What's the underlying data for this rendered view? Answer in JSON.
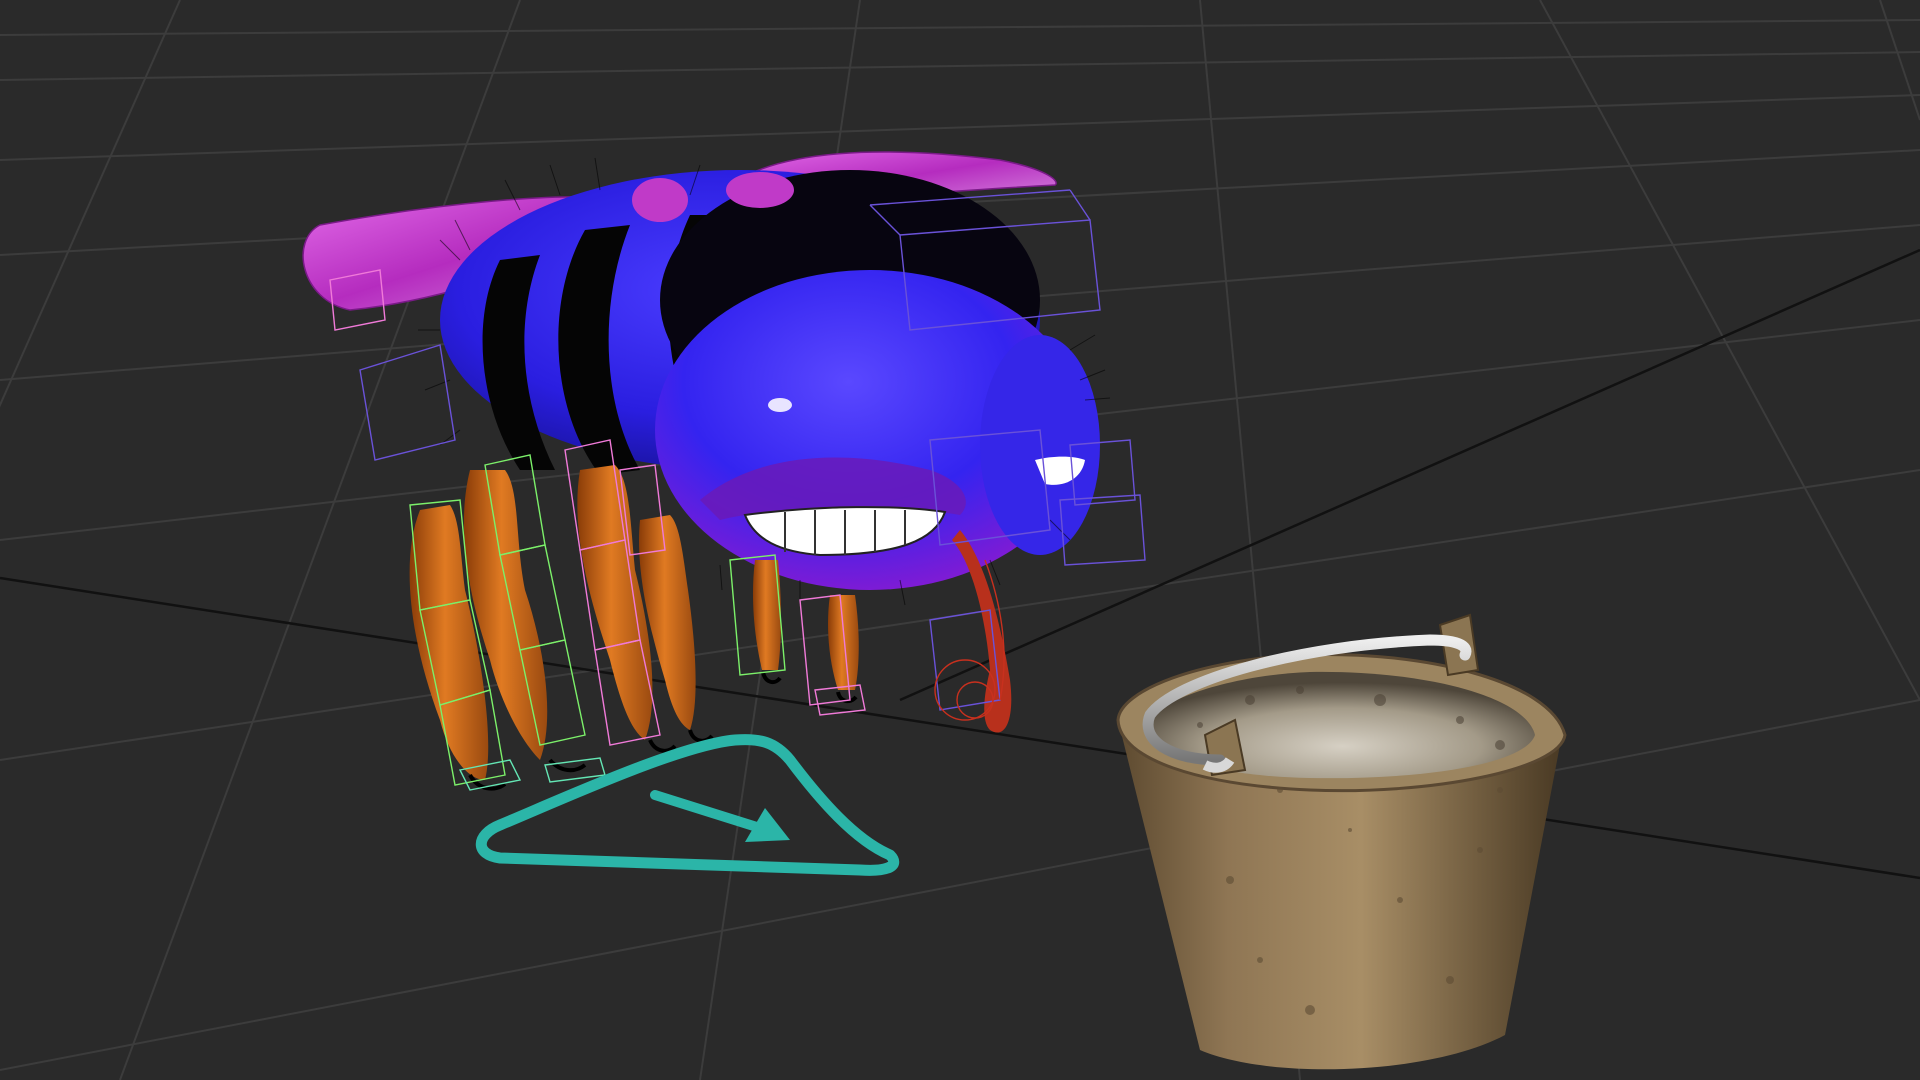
{
  "viewport": {
    "background_color": "#2a2a2a",
    "grid_color": "#3c3c3c",
    "grid_major_color": "#111111",
    "view": "perspective",
    "grid": true
  },
  "scene": {
    "objects": [
      {
        "name": "bee",
        "body_color": "#2a1ee0",
        "stripe_color": "#050505",
        "wing_color": "#c43ccf",
        "leg_color": "#d4701e"
      },
      {
        "name": "bucket",
        "outer_color": "#8f7654",
        "inner_color": "#b3aa9a",
        "handle_color": "#bcbcbc"
      },
      {
        "name": "movement-control",
        "color": "#2bb5a8",
        "icon": "triangle-arrow-control"
      }
    ],
    "bone_colors": [
      "#7cf06a",
      "#f07ad8",
      "#6a52d8",
      "#64e6b4",
      "#c8301e"
    ]
  }
}
